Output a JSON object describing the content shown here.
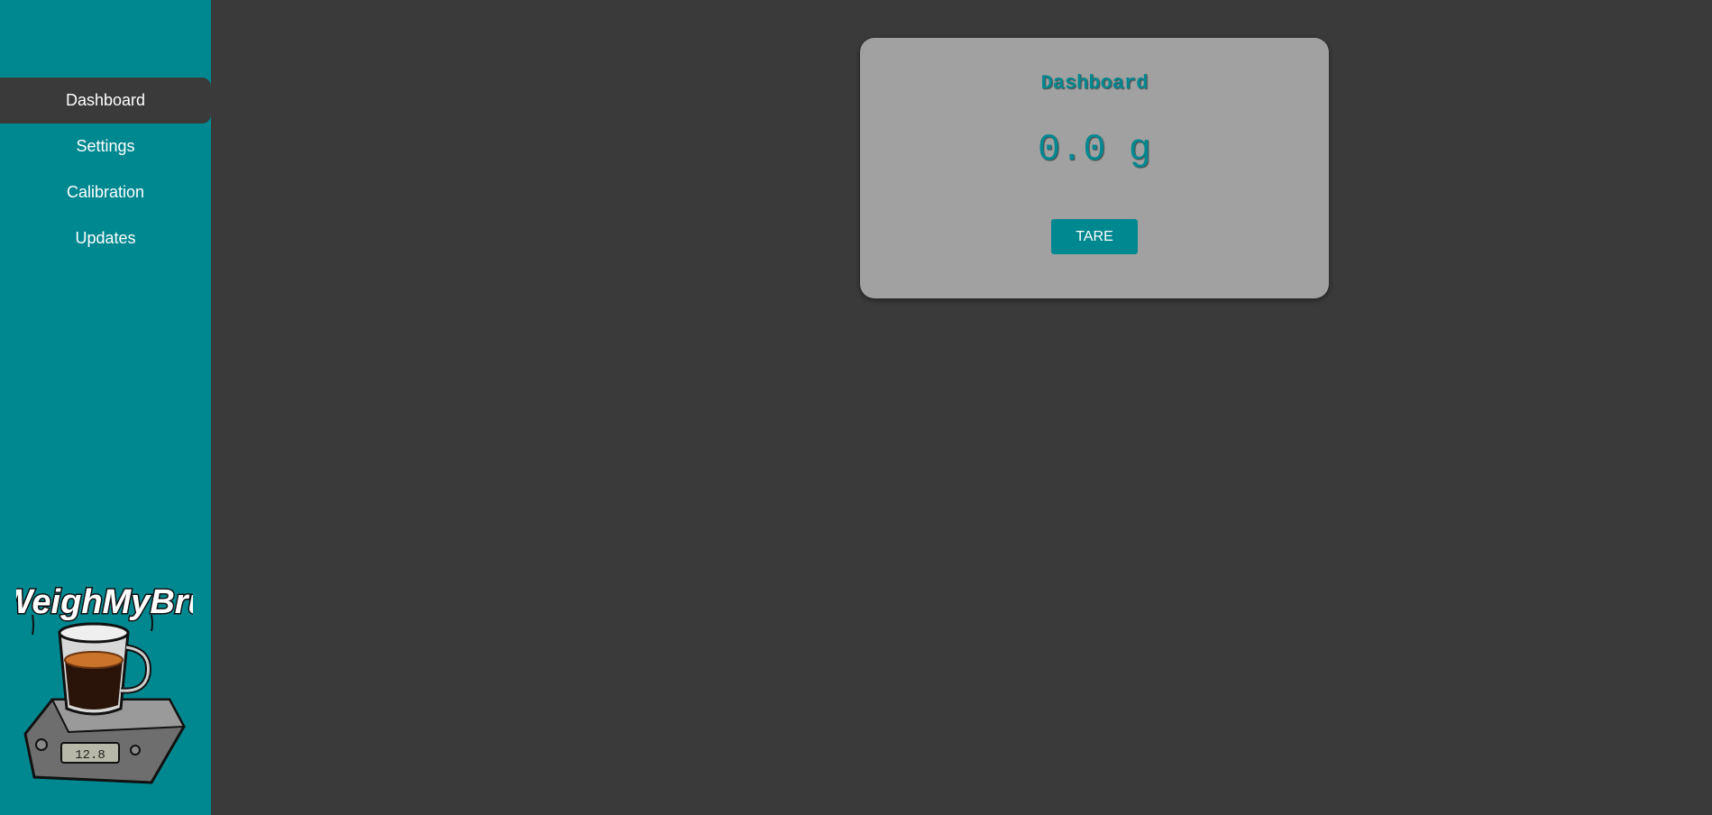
{
  "sidebar": {
    "items": [
      {
        "label": "Dashboard",
        "active": true
      },
      {
        "label": "Settings",
        "active": false
      },
      {
        "label": "Calibration",
        "active": false
      },
      {
        "label": "Updates",
        "active": false
      }
    ],
    "logo": {
      "wordmark": "WeighMyBru",
      "scale_display": "12.8",
      "icon": "coffee-cup-on-scale-logo"
    }
  },
  "dashboard": {
    "title": "Dashboard",
    "weight": "0.0 g",
    "tare_label": "TARE"
  },
  "colors": {
    "accent": "#008890",
    "background": "#3a3a3a",
    "card": "#a1a1a1",
    "text_light": "#ffffff"
  }
}
